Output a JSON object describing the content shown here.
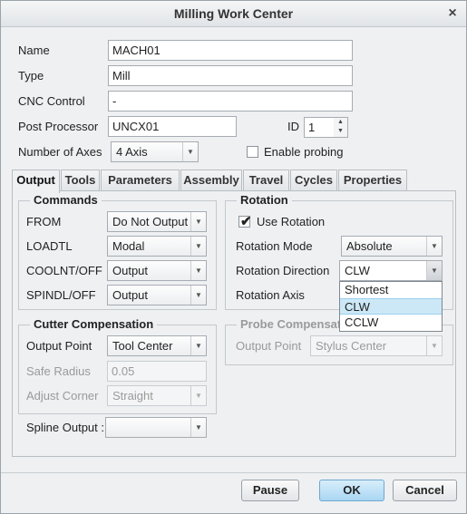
{
  "window": {
    "title": "Milling Work Center",
    "close_glyph": "×"
  },
  "general": {
    "name_label": "Name",
    "name_value": "MACH01",
    "type_label": "Type",
    "type_value": "Mill",
    "cnc_label": "CNC Control",
    "cnc_value": "-",
    "post_label": "Post Processor",
    "post_value": "UNCX01",
    "id_label": "ID",
    "id_value": "1",
    "axes_label": "Number of Axes",
    "axes_value": "4 Axis",
    "probing_label": "Enable probing",
    "probing_checked": false
  },
  "tabs": [
    "Output",
    "Tools",
    "Parameters",
    "Assembly",
    "Travel",
    "Cycles",
    "Properties"
  ],
  "active_tab": "Output",
  "commands": {
    "title": "Commands",
    "rows": [
      {
        "label": "FROM",
        "value": "Do Not Output"
      },
      {
        "label": "LOADTL",
        "value": "Modal"
      },
      {
        "label": "COOLNT/OFF",
        "value": "Output"
      },
      {
        "label": "SPINDL/OFF",
        "value": "Output"
      }
    ]
  },
  "rotation": {
    "title": "Rotation",
    "use_label": "Use Rotation",
    "use_checked": true,
    "mode_label": "Rotation Mode",
    "mode_value": "Absolute",
    "direction_label": "Rotation Direction",
    "direction_value": "CLW",
    "axis_label": "Rotation Axis",
    "direction_options": [
      "Shortest",
      "CLW",
      "CCLW"
    ],
    "direction_selected": "CLW"
  },
  "cutter": {
    "title": "Cutter Compensation",
    "output_label": "Output Point",
    "output_value": "Tool Center",
    "radius_label": "Safe Radius",
    "radius_value": "0.05",
    "corner_label": "Adjust Corner",
    "corner_value": "Straight"
  },
  "probe": {
    "title": "Probe Compensation",
    "output_label": "Output Point",
    "output_value": "Stylus Center"
  },
  "spline": {
    "label": "Spline Output :",
    "value": ""
  },
  "buttons": {
    "pause": "Pause",
    "ok": "OK",
    "cancel": "Cancel"
  },
  "icons": {
    "dropdown": "▼",
    "spin_up": "▲",
    "spin_down": "▼",
    "checkmark": "✔"
  },
  "colors": {
    "selection": "#cce8f7",
    "ok_button": "#a9d6f3"
  }
}
